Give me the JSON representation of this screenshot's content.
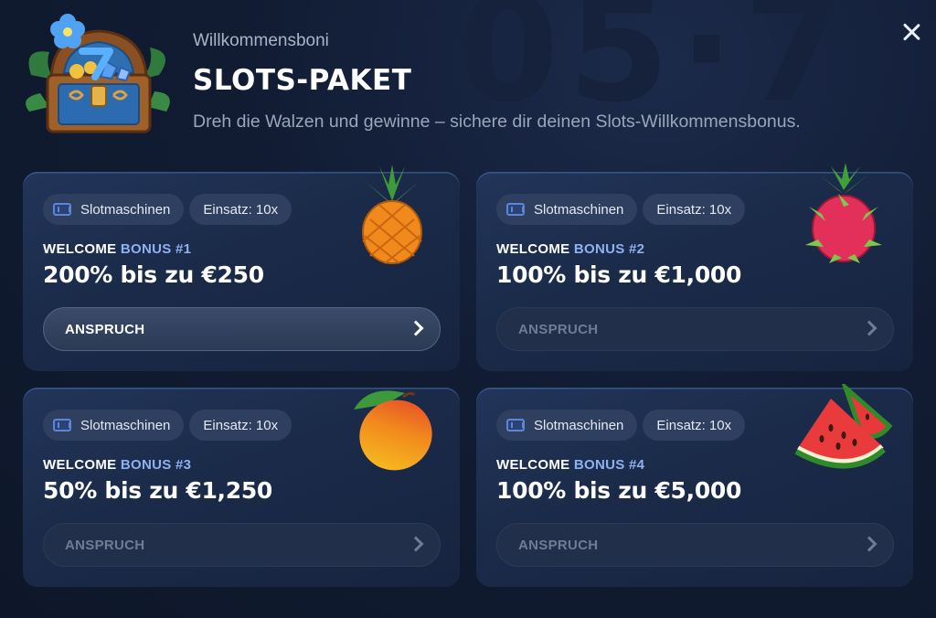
{
  "header": {
    "subtitle": "Willkommensboni",
    "title": "SLOTS-PAKET",
    "description": "Dreh die Walzen und gewinne – sichere dir deinen Slots-Willkommensbonus."
  },
  "colors": {
    "background": "#111c33",
    "card": "#1a2a48",
    "accent_label": "#8fb1f0",
    "chip": "#2e3f60"
  },
  "bonuses": [
    {
      "chip_category": "Slotmaschinen",
      "chip_wager": "Einsatz: 10x",
      "label_prefix": "WELCOME",
      "label_suffix": "BONUS #1",
      "offer": "200% bis zu €250",
      "button": "ANSPRUCH",
      "button_state": "active",
      "fruit_icon": "pineapple-icon"
    },
    {
      "chip_category": "Slotmaschinen",
      "chip_wager": "Einsatz: 10x",
      "label_prefix": "WELCOME",
      "label_suffix": "BONUS #2",
      "offer": "100% bis zu €1,000",
      "button": "ANSPRUCH",
      "button_state": "inactive",
      "fruit_icon": "dragonfruit-icon"
    },
    {
      "chip_category": "Slotmaschinen",
      "chip_wager": "Einsatz: 10x",
      "label_prefix": "WELCOME",
      "label_suffix": "BONUS #3",
      "offer": "50% bis zu €1,250",
      "button": "ANSPRUCH",
      "button_state": "inactive",
      "fruit_icon": "mango-icon"
    },
    {
      "chip_category": "Slotmaschinen",
      "chip_wager": "Einsatz: 10x",
      "label_prefix": "WELCOME",
      "label_suffix": "BONUS #4",
      "offer": "100% bis zu €5,000",
      "button": "ANSPRUCH",
      "button_state": "inactive",
      "fruit_icon": "watermelon-icon"
    }
  ]
}
